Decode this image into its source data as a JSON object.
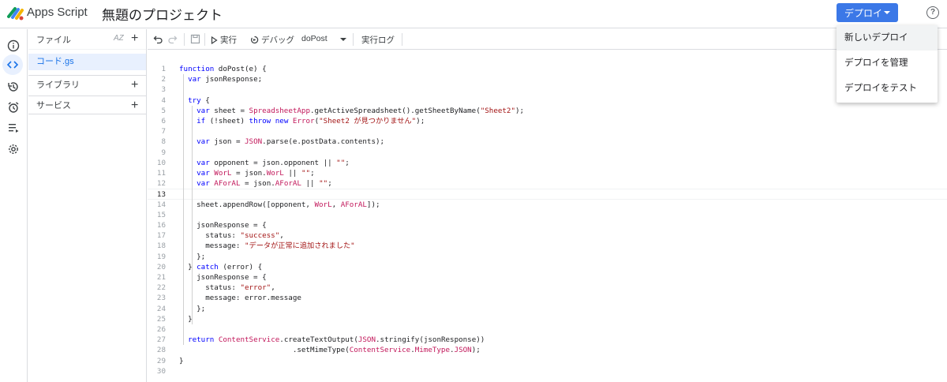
{
  "header": {
    "app_name": "Apps Script",
    "project_title": "無題のプロジェクト",
    "deploy_label": "デプロイ",
    "help_icon": "?"
  },
  "deploy_menu": {
    "items": [
      "新しいデプロイ",
      "デプロイを管理",
      "デプロイをテスト"
    ]
  },
  "files_panel": {
    "title": "ファイル",
    "sort_icon": "AZ",
    "active_file": "コード.gs",
    "libraries": "ライブラリ",
    "services": "サービス",
    "add_icon": "+"
  },
  "toolbar": {
    "run_label": "実行",
    "debug_label": "デバッグ",
    "function_name": "doPost",
    "log_label": "実行ログ"
  },
  "editor": {
    "current_line": 13,
    "lines": [
      {
        "n": "1",
        "t": "function doPost(e) {"
      },
      {
        "n": "2",
        "t": "  var jsonResponse;"
      },
      {
        "n": "3",
        "t": ""
      },
      {
        "n": "4",
        "t": "  try {"
      },
      {
        "n": "5",
        "t": "    var sheet = SpreadsheetApp.getActiveSpreadsheet().getSheetByName(\"Sheet2\");"
      },
      {
        "n": "6",
        "t": "    if (!sheet) throw new Error(\"Sheet2 が見つかりません\");"
      },
      {
        "n": "7",
        "t": ""
      },
      {
        "n": "8",
        "t": "    var json = JSON.parse(e.postData.contents);"
      },
      {
        "n": "9",
        "t": ""
      },
      {
        "n": "10",
        "t": "    var opponent = json.opponent || \"\";"
      },
      {
        "n": "11",
        "t": "    var WorL = json.WorL || \"\";"
      },
      {
        "n": "12",
        "t": "    var AForAL = json.AForAL || \"\";"
      },
      {
        "n": "13",
        "t": ""
      },
      {
        "n": "14",
        "t": "    sheet.appendRow([opponent, WorL, AForAL]);"
      },
      {
        "n": "15",
        "t": ""
      },
      {
        "n": "16",
        "t": "    jsonResponse = {"
      },
      {
        "n": "17",
        "t": "      status: \"success\","
      },
      {
        "n": "18",
        "t": "      message: \"データが正常に追加されました\""
      },
      {
        "n": "19",
        "t": "    };"
      },
      {
        "n": "20",
        "t": "  } catch (error) {"
      },
      {
        "n": "21",
        "t": "    jsonResponse = {"
      },
      {
        "n": "22",
        "t": "      status: \"error\","
      },
      {
        "n": "23",
        "t": "      message: error.message"
      },
      {
        "n": "24",
        "t": "    };"
      },
      {
        "n": "25",
        "t": "  }"
      },
      {
        "n": "26",
        "t": ""
      },
      {
        "n": "27",
        "t": "  return ContentService.createTextOutput(JSON.stringify(jsonResponse))"
      },
      {
        "n": "28",
        "t": "                          .setMimeType(ContentService.MimeType.JSON);"
      },
      {
        "n": "29",
        "t": "}"
      },
      {
        "n": "30",
        "t": ""
      }
    ]
  },
  "colors": {
    "accent": "#3b78e7",
    "active_file_bg": "#e8f0fe",
    "active_file_text": "#1a73e8",
    "keyword": "#0000ff",
    "string": "#a31515",
    "class": "#c2185b"
  }
}
